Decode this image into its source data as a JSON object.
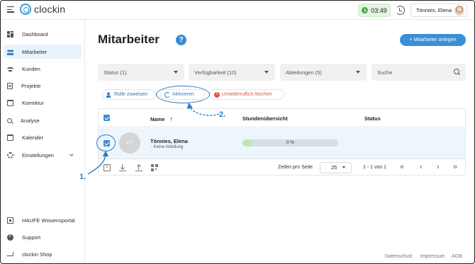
{
  "app": {
    "name": "clockin"
  },
  "header": {
    "timer": "03:49",
    "user_name": "Tönnies, Elena"
  },
  "sidebar": {
    "items": [
      {
        "label": "Dashboard",
        "icon": "dashboard-icon",
        "active": false
      },
      {
        "label": "Mitarbeiter",
        "icon": "team-icon",
        "active": true
      },
      {
        "label": "Kunden",
        "icon": "handshake-icon",
        "active": false
      },
      {
        "label": "Projekte",
        "icon": "document-icon",
        "active": false
      },
      {
        "label": "Korrektur",
        "icon": "calendar-edit-icon",
        "active": false
      },
      {
        "label": "Analyse",
        "icon": "search-icon",
        "active": false
      },
      {
        "label": "Kalender",
        "icon": "calendar-icon",
        "active": false
      },
      {
        "label": "Einstellungen",
        "icon": "gear-icon",
        "active": false
      }
    ],
    "bottom_items": [
      {
        "label": "HAUFE Wissensportal",
        "icon": "book-icon"
      },
      {
        "label": "Support",
        "icon": "info-icon"
      },
      {
        "label": "clockin Shop",
        "icon": "cart-icon"
      }
    ]
  },
  "main": {
    "title": "Mitarbeiter",
    "help": "?",
    "add_button": "+ Mitarbeiter anlegen",
    "filters": {
      "status": "Status (1)",
      "availability": "Verfügbarkeit (10)",
      "departments": "Abteilungen (5)",
      "search_placeholder": "Suche"
    },
    "actions": {
      "assign_role": "Rolle zuweisen",
      "activate": "Aktivieren",
      "delete": "Unwiderruflich löschen"
    },
    "table": {
      "columns": {
        "name": "Name",
        "hours": "Stundenübersicht",
        "status": "Status"
      },
      "sort_arrow": "↑",
      "rows": [
        {
          "initials": "ET",
          "name": "Tönnies, Elena",
          "department": "- Keine Abteilung",
          "hours_percent": 0,
          "hours_label": "0 %",
          "selected": true
        }
      ],
      "footer": {
        "rows_per_page_label": "Zeilen pro Seite",
        "rows_per_page": "25",
        "range": "1 - 1 von 1",
        "first": "«",
        "prev": "‹",
        "next": "›",
        "last": "»"
      }
    }
  },
  "footer": {
    "links": [
      "Datenschutz",
      "Impressum",
      "AGB"
    ]
  },
  "annotations": {
    "step1": "1.",
    "step2": "2."
  },
  "colors": {
    "accent": "#3a8fd6",
    "active_row": "#eef6fd",
    "timer_green": "#3fae49",
    "danger": "#e0544b"
  }
}
